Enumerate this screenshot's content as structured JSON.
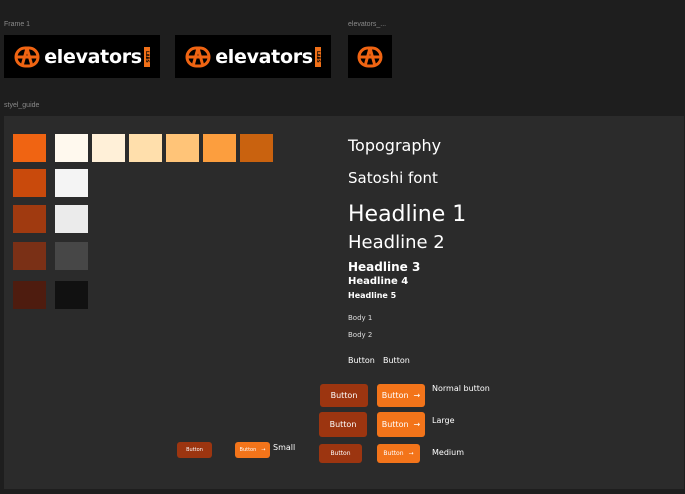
{
  "frames": {
    "frame1_label": "Frame 1",
    "elevators_label": "elevators_...",
    "style_guide_label": "styel_guide"
  },
  "logo": {
    "word": "elevators",
    "tag": "LABS"
  },
  "colors": {
    "row1": [
      "#f06412",
      "#fff9ee",
      "#fff0d8",
      "#ffdfac",
      "#ffc478",
      "#fc9e3e",
      "#c9620f"
    ],
    "col1": [
      "#f06412",
      "#c94a0c",
      "#a03a10",
      "#7a3016",
      "#4e1c0f"
    ],
    "col2": [
      "#fff9ee",
      "#f4f4f4",
      "#ebebeb",
      "#474747",
      "#111111"
    ]
  },
  "typography": {
    "title": "Topography",
    "font_name": "Satoshi font",
    "h1": "Headline 1",
    "h2": "Headline 2",
    "h3": "Headline 3",
    "h4": "Headline 4",
    "h5": "Headline 5",
    "body1": "Body 1",
    "body2": "Body 2",
    "button_a": "Button",
    "button_b": "Button"
  },
  "buttons": {
    "label": "Button",
    "arrow": "→",
    "normal_label": "Normal button",
    "large_label": "Large",
    "medium_label": "Medium",
    "small_label": "Small",
    "dark_color": "#9c3510",
    "orange_color": "#f3741a"
  }
}
